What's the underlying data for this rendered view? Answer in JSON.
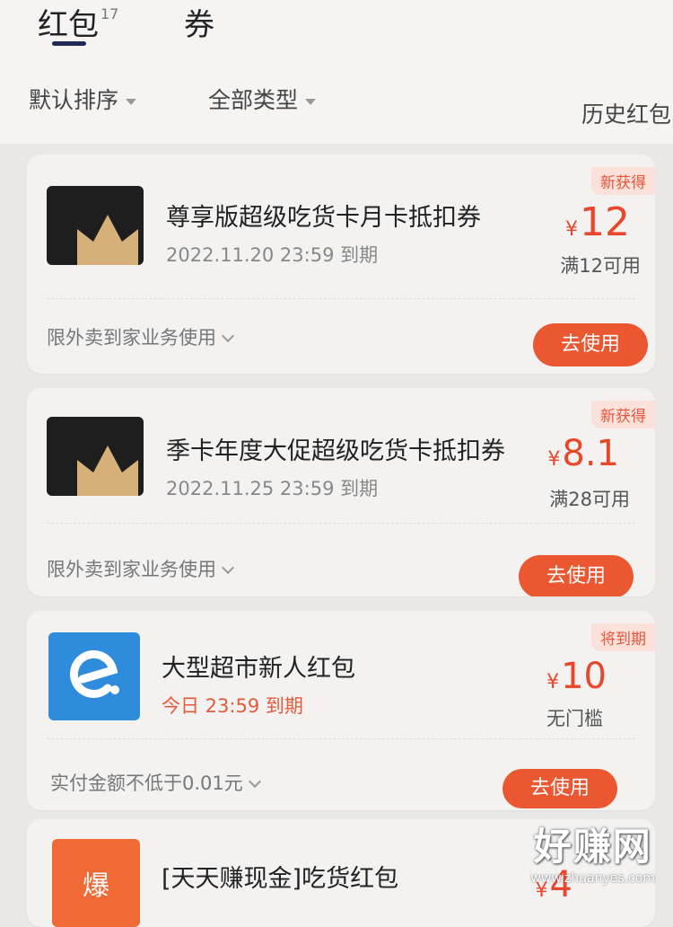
{
  "tabs": {
    "hongbao_label": "红包",
    "hongbao_count": "17",
    "juan_label": "券"
  },
  "filters": {
    "sort": "默认排序",
    "type": "全部类型",
    "history": "历史红包"
  },
  "coupons": [
    {
      "badge": "新获得",
      "title": "尊享版超级吃货卡月卡抵扣券",
      "expire": "2022.11.20 23:59 到期",
      "currency": "¥",
      "amount": "12",
      "condition": "满12可用",
      "scope": "限外卖到家业务使用",
      "button": "去使用",
      "icon": "crown-icon"
    },
    {
      "badge": "新获得",
      "title": "季卡年度大促超级吃货卡抵扣券",
      "expire": "2022.11.25 23:59 到期",
      "currency": "¥",
      "amount": "8.1",
      "condition": "满28可用",
      "scope": "限外卖到家业务使用",
      "button": "去使用",
      "icon": "crown-icon"
    },
    {
      "badge": "将到期",
      "title": "大型超市新人红包",
      "expire": "今日 23:59 到期",
      "currency": "¥",
      "amount": "10",
      "condition": "无门槛",
      "scope": "实付金额不低于0.01元",
      "button": "去使用",
      "icon": "eleme-logo-icon"
    },
    {
      "title": "[天天赚现金]吃货红包",
      "icon_text": "爆",
      "currency": "¥",
      "amount": "4",
      "icon": "bao-icon"
    }
  ],
  "watermark": {
    "main": "好赚网",
    "sub": "www.zhuanyes.com"
  },
  "colors": {
    "accent": "#ea5730",
    "amount": "#e8472c",
    "badge_bg": "#fbe1da"
  }
}
